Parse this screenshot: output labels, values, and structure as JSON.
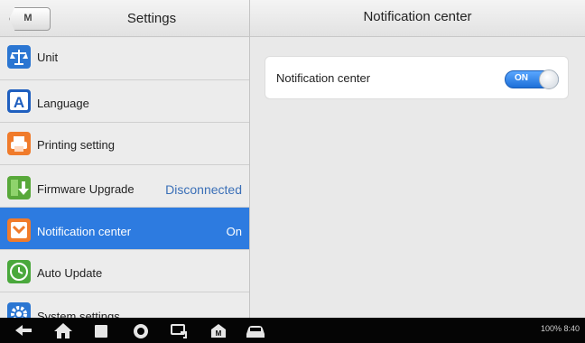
{
  "header": {
    "left_title": "Settings",
    "right_title": "Notification center",
    "home_glyph": "M"
  },
  "menu": [
    {
      "label": "Unit",
      "value": "",
      "icon": "scale-icon",
      "color": "#2b76d2"
    },
    {
      "label": "Language",
      "value": "",
      "icon": "language-a-icon",
      "color": "#1f5fbf"
    },
    {
      "label": "Printing setting",
      "value": "",
      "icon": "printer-icon",
      "color": "#f07b2b"
    },
    {
      "label": "Firmware Upgrade",
      "value": "Disconnected",
      "icon": "firmware-download-icon",
      "color": "#58a83a"
    },
    {
      "label": "Notification center",
      "value": "On",
      "icon": "notification-icon",
      "color": "#f07b2b",
      "selected": true
    },
    {
      "label": "Auto Update",
      "value": "",
      "icon": "clock-update-icon",
      "color": "#4aa83c"
    },
    {
      "label": "System settings",
      "value": "",
      "icon": "gear-icon",
      "color": "#2b76d2"
    }
  ],
  "detail": {
    "label": "Notification center",
    "toggle_text": "ON"
  },
  "navbar": {
    "status_text": "100% 8:40",
    "icons": [
      "back-icon",
      "home-icon",
      "recent-apps-icon",
      "browser-icon",
      "remote-icon",
      "maxisys-icon",
      "car-icon"
    ]
  },
  "colors": {
    "accent": "#2d7be0",
    "value_text": "#3a6fb7"
  }
}
